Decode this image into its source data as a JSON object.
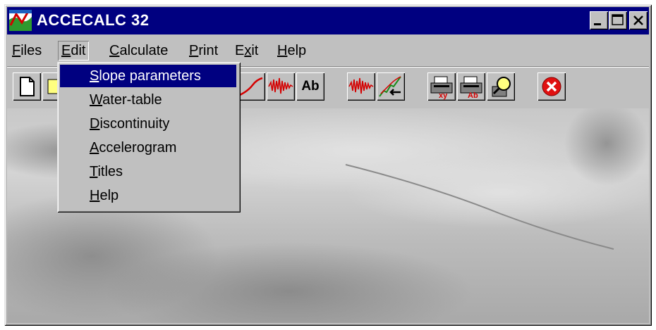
{
  "window": {
    "title": "ACCECALC 32",
    "controls": [
      "minimize",
      "maximize",
      "close"
    ]
  },
  "menubar": {
    "items": [
      {
        "label": "Files",
        "accel": "F"
      },
      {
        "label": "Edit",
        "accel": "E"
      },
      {
        "label": "Calculate",
        "accel": "C"
      },
      {
        "label": "Print",
        "accel": "P"
      },
      {
        "label": "Exit",
        "accel": "x"
      },
      {
        "label": "Help",
        "accel": "H"
      }
    ]
  },
  "edit_menu": {
    "items": [
      {
        "label": "Slope parameters",
        "accel": "S",
        "selected": true
      },
      {
        "label": "Water-table",
        "accel": "W",
        "selected": false
      },
      {
        "label": "Discontinuity",
        "accel": "D",
        "selected": false
      },
      {
        "label": "Accelerogram",
        "accel": "A",
        "selected": false
      },
      {
        "label": "Titles",
        "accel": "T",
        "selected": false
      },
      {
        "label": "Help",
        "accel": "H",
        "selected": false
      }
    ]
  },
  "toolbar": {
    "ab_label": "Ab",
    "buttons": [
      "new-document-icon",
      "open-icon",
      "slope-curve-icon",
      "accelerogram-icon",
      "titles-ab-icon",
      "accelerogram-edit-icon",
      "slope-arrow-icon",
      "print-xy-icon",
      "print-ab-icon",
      "print-preview-icon",
      "exit-icon"
    ]
  },
  "colors": {
    "titlebar": "#000080",
    "face": "#c0c0c0",
    "selection": "#000080",
    "accent_red": "#d40000"
  }
}
